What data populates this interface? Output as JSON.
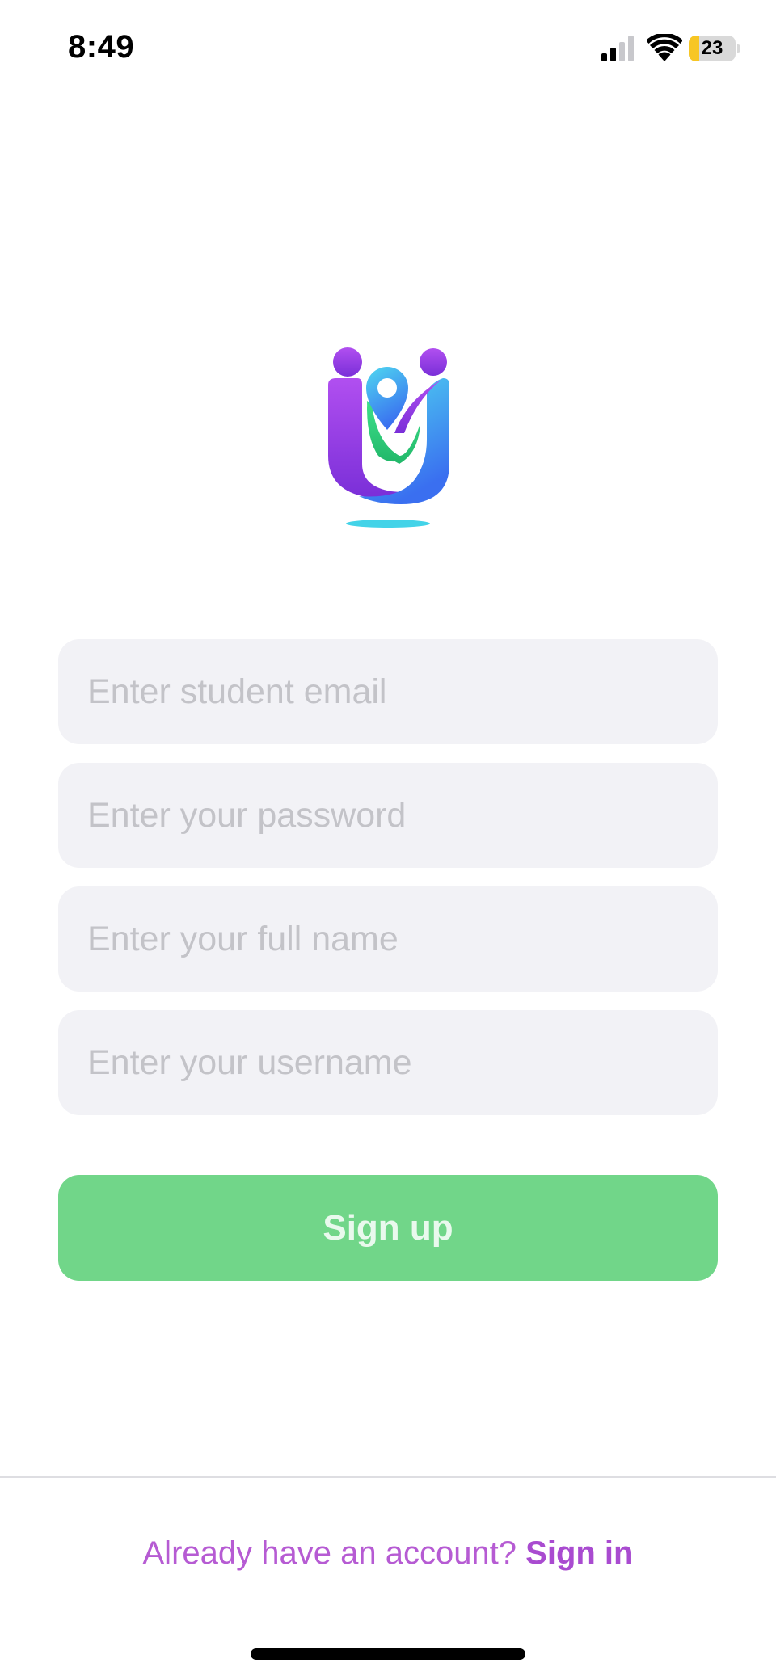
{
  "status_bar": {
    "time": "8:49",
    "battery_level": "23",
    "battery_fraction": 0.23,
    "icons": [
      "signal-icon",
      "wifi-icon",
      "battery-icon"
    ]
  },
  "logo": {
    "icon": "app-logo-icon",
    "colors": {
      "purple": "#9b3fe0",
      "green": "#35d07f",
      "blue": "#3f8ef0",
      "cyan": "#43d3e8"
    }
  },
  "form": {
    "email_placeholder": "Enter student email",
    "email_value": "",
    "password_placeholder": "Enter your password",
    "password_value": "",
    "fullname_placeholder": "Enter your full name",
    "fullname_value": "",
    "username_placeholder": "Enter your username",
    "username_value": "",
    "signup_label": "Sign up"
  },
  "footer": {
    "prompt": "Already have an account?",
    "signin_label": "Sign in"
  },
  "colors": {
    "field_background": "#f2f2f6",
    "placeholder": "#c3c3c8",
    "primary_button": "#71d689",
    "link_purple": "#b65bd3"
  }
}
